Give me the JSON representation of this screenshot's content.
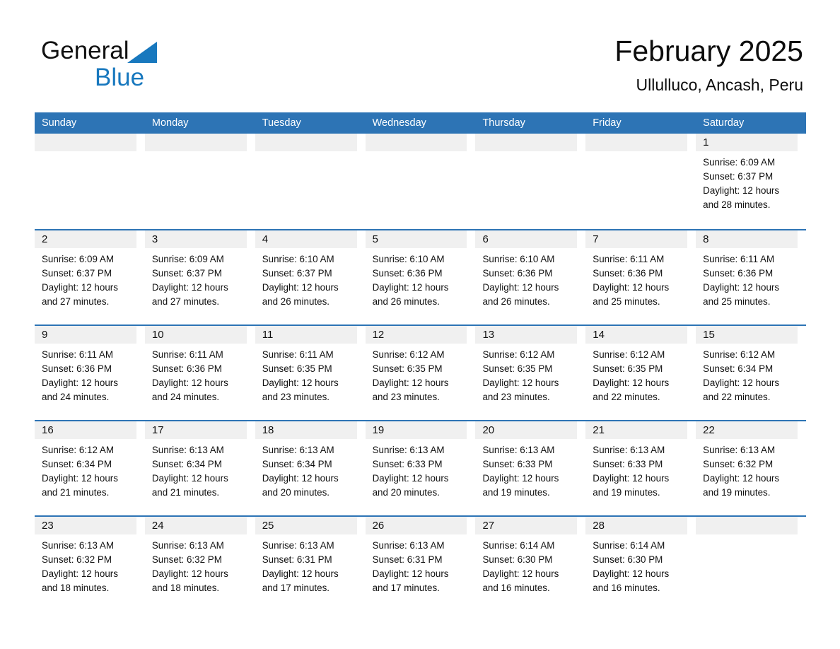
{
  "brand": {
    "name_part1": "General",
    "name_part2": "Blue",
    "accent_color": "#1878be"
  },
  "header": {
    "title": "February 2025",
    "subtitle": "Ullulluco, Ancash, Peru"
  },
  "calendar": {
    "header_bg": "#2d74b5",
    "daynum_band_bg": "#f0f0f0",
    "weekdays": [
      "Sunday",
      "Monday",
      "Tuesday",
      "Wednesday",
      "Thursday",
      "Friday",
      "Saturday"
    ],
    "weeks": [
      {
        "days": [
          {
            "date": "",
            "lines": []
          },
          {
            "date": "",
            "lines": []
          },
          {
            "date": "",
            "lines": []
          },
          {
            "date": "",
            "lines": []
          },
          {
            "date": "",
            "lines": []
          },
          {
            "date": "",
            "lines": []
          },
          {
            "date": "1",
            "lines": [
              "Sunrise: 6:09 AM",
              "Sunset: 6:37 PM",
              "Daylight: 12 hours",
              "and 28 minutes."
            ]
          }
        ]
      },
      {
        "days": [
          {
            "date": "2",
            "lines": [
              "Sunrise: 6:09 AM",
              "Sunset: 6:37 PM",
              "Daylight: 12 hours",
              "and 27 minutes."
            ]
          },
          {
            "date": "3",
            "lines": [
              "Sunrise: 6:09 AM",
              "Sunset: 6:37 PM",
              "Daylight: 12 hours",
              "and 27 minutes."
            ]
          },
          {
            "date": "4",
            "lines": [
              "Sunrise: 6:10 AM",
              "Sunset: 6:37 PM",
              "Daylight: 12 hours",
              "and 26 minutes."
            ]
          },
          {
            "date": "5",
            "lines": [
              "Sunrise: 6:10 AM",
              "Sunset: 6:36 PM",
              "Daylight: 12 hours",
              "and 26 minutes."
            ]
          },
          {
            "date": "6",
            "lines": [
              "Sunrise: 6:10 AM",
              "Sunset: 6:36 PM",
              "Daylight: 12 hours",
              "and 26 minutes."
            ]
          },
          {
            "date": "7",
            "lines": [
              "Sunrise: 6:11 AM",
              "Sunset: 6:36 PM",
              "Daylight: 12 hours",
              "and 25 minutes."
            ]
          },
          {
            "date": "8",
            "lines": [
              "Sunrise: 6:11 AM",
              "Sunset: 6:36 PM",
              "Daylight: 12 hours",
              "and 25 minutes."
            ]
          }
        ]
      },
      {
        "days": [
          {
            "date": "9",
            "lines": [
              "Sunrise: 6:11 AM",
              "Sunset: 6:36 PM",
              "Daylight: 12 hours",
              "and 24 minutes."
            ]
          },
          {
            "date": "10",
            "lines": [
              "Sunrise: 6:11 AM",
              "Sunset: 6:36 PM",
              "Daylight: 12 hours",
              "and 24 minutes."
            ]
          },
          {
            "date": "11",
            "lines": [
              "Sunrise: 6:11 AM",
              "Sunset: 6:35 PM",
              "Daylight: 12 hours",
              "and 23 minutes."
            ]
          },
          {
            "date": "12",
            "lines": [
              "Sunrise: 6:12 AM",
              "Sunset: 6:35 PM",
              "Daylight: 12 hours",
              "and 23 minutes."
            ]
          },
          {
            "date": "13",
            "lines": [
              "Sunrise: 6:12 AM",
              "Sunset: 6:35 PM",
              "Daylight: 12 hours",
              "and 23 minutes."
            ]
          },
          {
            "date": "14",
            "lines": [
              "Sunrise: 6:12 AM",
              "Sunset: 6:35 PM",
              "Daylight: 12 hours",
              "and 22 minutes."
            ]
          },
          {
            "date": "15",
            "lines": [
              "Sunrise: 6:12 AM",
              "Sunset: 6:34 PM",
              "Daylight: 12 hours",
              "and 22 minutes."
            ]
          }
        ]
      },
      {
        "days": [
          {
            "date": "16",
            "lines": [
              "Sunrise: 6:12 AM",
              "Sunset: 6:34 PM",
              "Daylight: 12 hours",
              "and 21 minutes."
            ]
          },
          {
            "date": "17",
            "lines": [
              "Sunrise: 6:13 AM",
              "Sunset: 6:34 PM",
              "Daylight: 12 hours",
              "and 21 minutes."
            ]
          },
          {
            "date": "18",
            "lines": [
              "Sunrise: 6:13 AM",
              "Sunset: 6:34 PM",
              "Daylight: 12 hours",
              "and 20 minutes."
            ]
          },
          {
            "date": "19",
            "lines": [
              "Sunrise: 6:13 AM",
              "Sunset: 6:33 PM",
              "Daylight: 12 hours",
              "and 20 minutes."
            ]
          },
          {
            "date": "20",
            "lines": [
              "Sunrise: 6:13 AM",
              "Sunset: 6:33 PM",
              "Daylight: 12 hours",
              "and 19 minutes."
            ]
          },
          {
            "date": "21",
            "lines": [
              "Sunrise: 6:13 AM",
              "Sunset: 6:33 PM",
              "Daylight: 12 hours",
              "and 19 minutes."
            ]
          },
          {
            "date": "22",
            "lines": [
              "Sunrise: 6:13 AM",
              "Sunset: 6:32 PM",
              "Daylight: 12 hours",
              "and 19 minutes."
            ]
          }
        ]
      },
      {
        "days": [
          {
            "date": "23",
            "lines": [
              "Sunrise: 6:13 AM",
              "Sunset: 6:32 PM",
              "Daylight: 12 hours",
              "and 18 minutes."
            ]
          },
          {
            "date": "24",
            "lines": [
              "Sunrise: 6:13 AM",
              "Sunset: 6:32 PM",
              "Daylight: 12 hours",
              "and 18 minutes."
            ]
          },
          {
            "date": "25",
            "lines": [
              "Sunrise: 6:13 AM",
              "Sunset: 6:31 PM",
              "Daylight: 12 hours",
              "and 17 minutes."
            ]
          },
          {
            "date": "26",
            "lines": [
              "Sunrise: 6:13 AM",
              "Sunset: 6:31 PM",
              "Daylight: 12 hours",
              "and 17 minutes."
            ]
          },
          {
            "date": "27",
            "lines": [
              "Sunrise: 6:14 AM",
              "Sunset: 6:30 PM",
              "Daylight: 12 hours",
              "and 16 minutes."
            ]
          },
          {
            "date": "28",
            "lines": [
              "Sunrise: 6:14 AM",
              "Sunset: 6:30 PM",
              "Daylight: 12 hours",
              "and 16 minutes."
            ]
          },
          {
            "date": "",
            "lines": []
          }
        ]
      }
    ]
  }
}
